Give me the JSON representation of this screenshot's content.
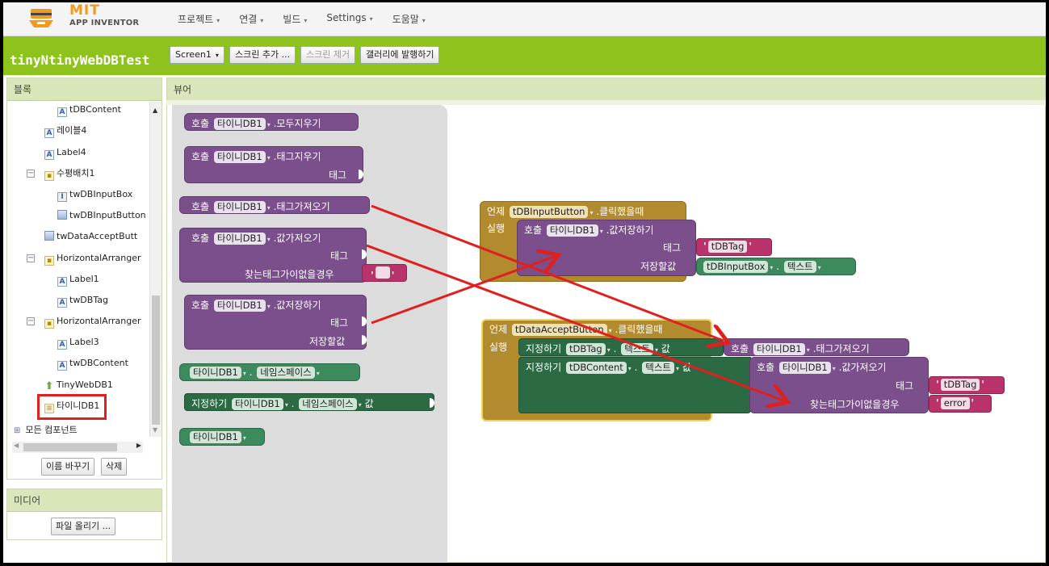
{
  "nav": {
    "logo_mit": "MIT",
    "logo_sub": "APP INVENTOR",
    "menu": [
      "프로젝트",
      "연결",
      "빌드",
      "Settings",
      "도움말"
    ]
  },
  "project": {
    "name": "tinyNtinyWebDBTest",
    "screen_button": "Screen1",
    "add_screen": "스크린 추가 ...",
    "remove_screen": "스크린 제거",
    "publish": "갤러리에 발행하기"
  },
  "blocks_panel": {
    "title": "블록",
    "tree": [
      {
        "label": "tDBContent",
        "indent": 2,
        "icon": "A"
      },
      {
        "label": "레이블4",
        "indent": 1,
        "icon": "A"
      },
      {
        "label": "Label4",
        "indent": 1,
        "icon": "A"
      },
      {
        "label": "수평배치1",
        "indent": 1,
        "icon": "arr",
        "toggle": "⊟"
      },
      {
        "label": "twDBInputBox",
        "indent": 2,
        "icon": "box"
      },
      {
        "label": "twDBInputButton",
        "indent": 2,
        "icon": "btn"
      },
      {
        "label": "twDataAcceptButt",
        "indent": 1,
        "icon": "btn"
      },
      {
        "label": "HorizontalArranger",
        "indent": 1,
        "icon": "arr",
        "toggle": "⊟"
      },
      {
        "label": "Label1",
        "indent": 2,
        "icon": "A"
      },
      {
        "label": "twDBTag",
        "indent": 2,
        "icon": "A"
      },
      {
        "label": "HorizontalArranger",
        "indent": 1,
        "icon": "arr",
        "toggle": "⊟"
      },
      {
        "label": "Label3",
        "indent": 2,
        "icon": "A"
      },
      {
        "label": "twDBContent",
        "indent": 2,
        "icon": "A"
      },
      {
        "label": "TinyWebDB1",
        "indent": 1,
        "icon": "db"
      },
      {
        "label": "타이니DB1",
        "indent": 1,
        "icon": "stk"
      }
    ],
    "all_components": "모든 컴포넌트",
    "rename_button": "이름 바꾸기",
    "delete_button": "삭제"
  },
  "media_panel": {
    "title": "미디어",
    "upload_button": "파일 올리기 ..."
  },
  "viewer": {
    "title": "뷰어"
  },
  "flyout_blocks": {
    "call": "호출",
    "comp": "타이니DB1",
    "clear_all": ".모두지우기",
    "clear_tag": ".태그지우기",
    "get_tags": ".태그가져오기",
    "get_value": ".값가져오기",
    "store_value": ".값저장하기",
    "tag": "태그",
    "not_found": "찾는태그가이없을경우",
    "value_to_store": "저장할값",
    "namespace": "네임스페이스",
    "set": "지정하기",
    "to": "값"
  },
  "ws_block1": {
    "when": "언제",
    "component": "tDBInputButton",
    "event": ".클릭했을때",
    "do": "실행",
    "call": "호출",
    "db": "타이니DB1",
    "method": ".값저장하기",
    "tag_label": "태그",
    "tag_value": "tDBTag",
    "store_label": "저장할값",
    "input": "tDBInputBox",
    "prop": "텍스트"
  },
  "ws_block2": {
    "when": "언제",
    "component": "tDataAcceptButton",
    "event": ".클릭했을때",
    "do": "실행",
    "set": "지정하기",
    "target1": "tDBTag",
    "prop": "텍스트",
    "to": "값",
    "call": "호출",
    "db": "타이니DB1",
    "method1": ".태그가져오기",
    "target2": "tDBContent",
    "method2": ".값가져오기",
    "tag_label": "태그",
    "tag_value": "tDBTag",
    "not_found": "찾는태그가이없을경우",
    "nf_value": "error"
  },
  "colors": {
    "project_bar": "#8ec21d",
    "procedure": "#7b4f8c",
    "event": "#b28b2e",
    "setter": "#2b6a43",
    "text": "#b9336a",
    "annotation": "#e0201f"
  }
}
